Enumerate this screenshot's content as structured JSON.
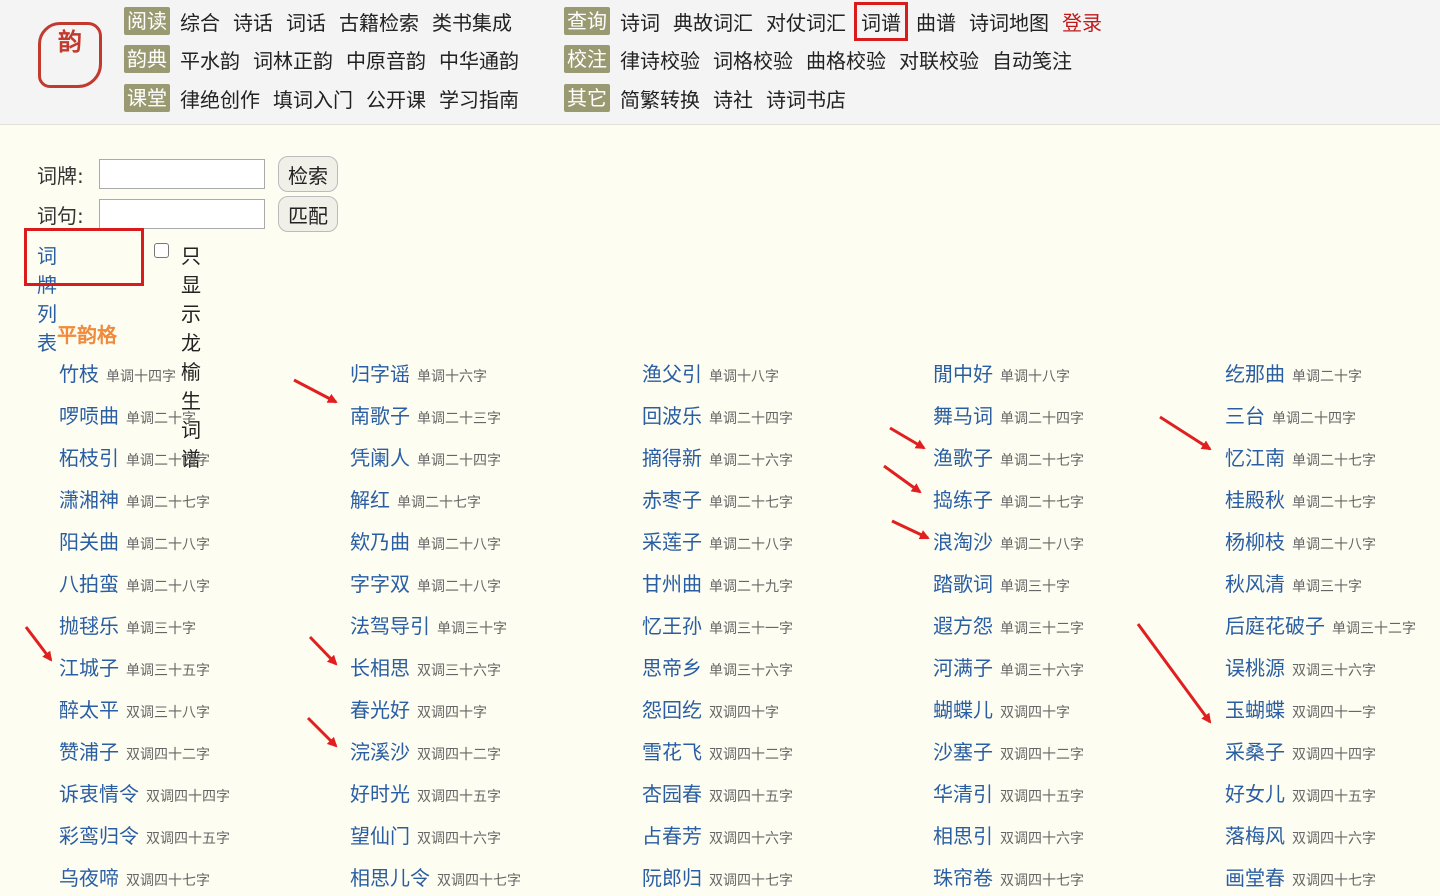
{
  "logo": {
    "text": "韵"
  },
  "nav": {
    "rows": [
      {
        "tag": "阅读",
        "links": [
          "综合",
          "诗话",
          "词话",
          "古籍检索",
          "类书集成"
        ]
      },
      {
        "tag": "韵典",
        "links": [
          "平水韵",
          "词林正韵",
          "中原音韵",
          "中华通韵"
        ]
      },
      {
        "tag": "课堂",
        "links": [
          "律绝创作",
          "填词入门",
          "公开课",
          "学习指南"
        ]
      },
      {
        "tag": "查询",
        "links": [
          "诗词",
          "典故词汇",
          "对仗词汇",
          "词谱",
          "曲谱",
          "诗词地图"
        ],
        "login": "登录"
      },
      {
        "tag": "校注",
        "links": [
          "律诗校验",
          "词格校验",
          "曲格校验",
          "对联校验",
          "自动笺注"
        ]
      },
      {
        "tag": "其它",
        "links": [
          "简繁转换",
          "诗社",
          "诗词书店"
        ]
      }
    ]
  },
  "form": {
    "cipai_label": "词牌:",
    "search_button": "检索",
    "ciju_label": "词句:",
    "match_button": "匹配",
    "list_link": "词牌列表",
    "checkbox_label": "只显示龙榆生词谱"
  },
  "section": {
    "title": "平韵格"
  },
  "columns": [
    [
      {
        "name": "竹枝",
        "info": "单调十四字"
      },
      {
        "name": "啰唝曲",
        "info": "单调二十字"
      },
      {
        "name": "柘枝引",
        "info": "单调二十四字"
      },
      {
        "name": "潇湘神",
        "info": "单调二十七字"
      },
      {
        "name": "阳关曲",
        "info": "单调二十八字"
      },
      {
        "name": "八拍蛮",
        "info": "单调二十八字"
      },
      {
        "name": "抛毬乐",
        "info": "单调三十字"
      },
      {
        "name": "江城子",
        "info": "单调三十五字"
      },
      {
        "name": "醉太平",
        "info": "双调三十八字"
      },
      {
        "name": "赞浦子",
        "info": "双调四十二字"
      },
      {
        "name": "诉衷情令",
        "info": "双调四十四字"
      },
      {
        "name": "彩鸾归令",
        "info": "双调四十五字"
      },
      {
        "name": "乌夜啼",
        "info": "双调四十七字"
      }
    ],
    [
      {
        "name": "归字谣",
        "info": "单调十六字"
      },
      {
        "name": "南歌子",
        "info": "单调二十三字"
      },
      {
        "name": "凭阑人",
        "info": "单调二十四字"
      },
      {
        "name": "解红",
        "info": "单调二十七字"
      },
      {
        "name": "欸乃曲",
        "info": "单调二十八字"
      },
      {
        "name": "字字双",
        "info": "单调二十八字"
      },
      {
        "name": "法驾导引",
        "info": "单调三十字"
      },
      {
        "name": "长相思",
        "info": "双调三十六字"
      },
      {
        "name": "春光好",
        "info": "双调四十字"
      },
      {
        "name": "浣溪沙",
        "info": "双调四十二字"
      },
      {
        "name": "好时光",
        "info": "双调四十五字"
      },
      {
        "name": "望仙门",
        "info": "双调四十六字"
      },
      {
        "name": "相思儿令",
        "info": "双调四十七字"
      }
    ],
    [
      {
        "name": "渔父引",
        "info": "单调十八字"
      },
      {
        "name": "回波乐",
        "info": "单调二十四字"
      },
      {
        "name": "摘得新",
        "info": "单调二十六字"
      },
      {
        "name": "赤枣子",
        "info": "单调二十七字"
      },
      {
        "name": "采莲子",
        "info": "单调二十八字"
      },
      {
        "name": "甘州曲",
        "info": "单调二十九字"
      },
      {
        "name": "忆王孙",
        "info": "单调三十一字"
      },
      {
        "name": "思帝乡",
        "info": "单调三十六字"
      },
      {
        "name": "怨回纥",
        "info": "双调四十字"
      },
      {
        "name": "雪花飞",
        "info": "双调四十二字"
      },
      {
        "name": "杏园春",
        "info": "双调四十五字"
      },
      {
        "name": "占春芳",
        "info": "双调四十六字"
      },
      {
        "name": "阮郎归",
        "info": "双调四十七字"
      }
    ],
    [
      {
        "name": "閒中好",
        "info": "单调十八字"
      },
      {
        "name": "舞马词",
        "info": "单调二十四字"
      },
      {
        "name": "渔歌子",
        "info": "单调二十七字"
      },
      {
        "name": "捣练子",
        "info": "单调二十七字"
      },
      {
        "name": "浪淘沙",
        "info": "单调二十八字"
      },
      {
        "name": "踏歌词",
        "info": "单调三十字"
      },
      {
        "name": "遐方怨",
        "info": "单调三十二字"
      },
      {
        "name": "河满子",
        "info": "单调三十六字"
      },
      {
        "name": "蝴蝶儿",
        "info": "双调四十字"
      },
      {
        "name": "沙塞子",
        "info": "双调四十二字"
      },
      {
        "name": "华清引",
        "info": "双调四十五字"
      },
      {
        "name": "相思引",
        "info": "双调四十六字"
      },
      {
        "name": "珠帘卷",
        "info": "双调四十七字"
      }
    ],
    [
      {
        "name": "纥那曲",
        "info": "单调二十字"
      },
      {
        "name": "三台",
        "info": "单调二十四字"
      },
      {
        "name": "忆江南",
        "info": "单调二十七字"
      },
      {
        "name": "桂殿秋",
        "info": "单调二十七字"
      },
      {
        "name": "杨柳枝",
        "info": "单调二十八字"
      },
      {
        "name": "秋风清",
        "info": "单调三十字"
      },
      {
        "name": "后庭花破子",
        "info": "单调三十二字"
      },
      {
        "name": "误桃源",
        "info": "双调三十六字"
      },
      {
        "name": "玉蝴蝶",
        "info": "双调四十一字"
      },
      {
        "name": "采桑子",
        "info": "双调四十四字"
      },
      {
        "name": "好女儿",
        "info": "双调四十五字"
      },
      {
        "name": "落梅风",
        "info": "双调四十六字"
      },
      {
        "name": "画堂春",
        "info": "双调四十七字"
      }
    ]
  ],
  "colors": {
    "link": "#2a5ea4",
    "accent": "#f08a3c",
    "tag_bg": "#9a9a72",
    "highlight": "#d91b1b"
  }
}
